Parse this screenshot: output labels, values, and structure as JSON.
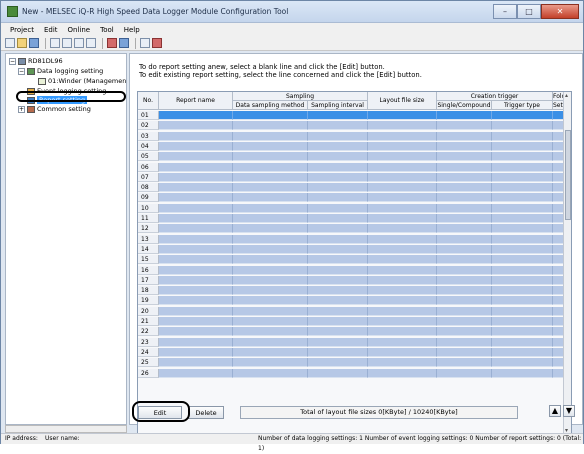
{
  "window": {
    "title": "New - MELSEC iQ-R High Speed Data Logger Module Configuration Tool"
  },
  "menu": [
    "Project",
    "Edit",
    "Online",
    "Tool",
    "Help"
  ],
  "tree": {
    "root": "RD81DL96",
    "data_logging": "Data logging setting",
    "winder": "01:Winder (Managemen",
    "event_logging": "Event logging setting",
    "report": "Report setting",
    "common": "Common setting"
  },
  "instructions": [
    "To do report setting anew, select a blank line and click the [Edit] button.",
    "To edit existing report setting, select the line concerned and click the [Edit] button."
  ],
  "table": {
    "headers": {
      "no": "No.",
      "report_name": "Report name",
      "sampling": "Sampling",
      "data_sampling_method": "Data sampling method",
      "sampling_interval": "Sampling interval",
      "layout_file_size": "Layout file size",
      "creation_trigger": "Creation trigger",
      "single_compound": "Single/Compound",
      "trigger_type": "Trigger type",
      "folder": "Folder",
      "folder_sub": "Setti"
    },
    "rows": [
      "01",
      "02",
      "03",
      "04",
      "05",
      "06",
      "07",
      "08",
      "09",
      "10",
      "11",
      "12",
      "13",
      "14",
      "15",
      "16",
      "17",
      "18",
      "19",
      "20",
      "21",
      "22",
      "23",
      "24",
      "25",
      "26"
    ]
  },
  "buttons": {
    "edit": "Edit",
    "delete": "Delete",
    "up": "▲",
    "down": "▼"
  },
  "total_size": "Total of layout file sizes 0[KByte] / 10240[KByte]",
  "status": {
    "ip": "IP address:",
    "user": "User name:",
    "counts": "Number of data logging settings: 1  Number of event logging settings: 0  Number of report settings: 0  (Total: 1)"
  }
}
